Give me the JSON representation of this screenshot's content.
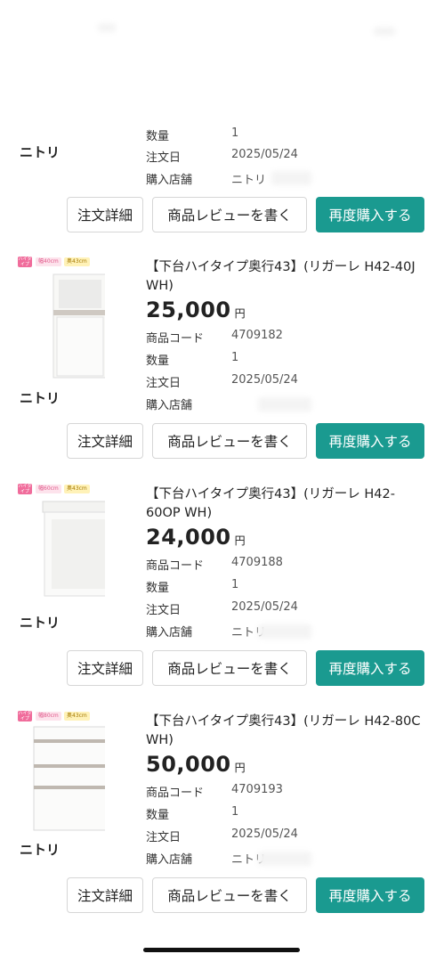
{
  "buttons": {
    "detail": "注文詳細",
    "review": "商品レビューを書く",
    "rebuy": "再度購入する"
  },
  "labels": {
    "product_code": "商品コード",
    "quantity": "数量",
    "order_date": "注文日",
    "store": "購入店舗",
    "yen": "円",
    "high_type": "ハイタイプ"
  },
  "orders": [
    {
      "brand": "ニトリ",
      "quantity": "1",
      "order_date": "2025/05/24",
      "store": "ニトリ"
    },
    {
      "brand": "ニトリ",
      "title": "【下台ハイタイプ奥行43】(リガーレ H42-40J WH)",
      "price": "25,000",
      "product_code": "4709182",
      "quantity": "1",
      "order_date": "2025/05/24",
      "store": "",
      "badge_width": "幅40cm",
      "badge_depth": "奥43cm"
    },
    {
      "brand": "ニトリ",
      "title": "【下台ハイタイプ奥行43】(リガーレ H42-60OP WH)",
      "price": "24,000",
      "product_code": "4709188",
      "quantity": "1",
      "order_date": "2025/05/24",
      "store": "ニトリ",
      "badge_width": "幅60cm",
      "badge_depth": "奥43cm"
    },
    {
      "brand": "ニトリ",
      "title": "【下台ハイタイプ奥行43】(リガーレ H42-80C WH)",
      "price": "50,000",
      "product_code": "4709193",
      "quantity": "1",
      "order_date": "2025/05/24",
      "store": "ニトリ",
      "badge_width": "幅80cm",
      "badge_depth": "奥43cm"
    }
  ],
  "colors": {
    "accent": "#1a9a90",
    "badge_pink": "#f06c9b",
    "badge_yellow": "#fff2b8"
  }
}
